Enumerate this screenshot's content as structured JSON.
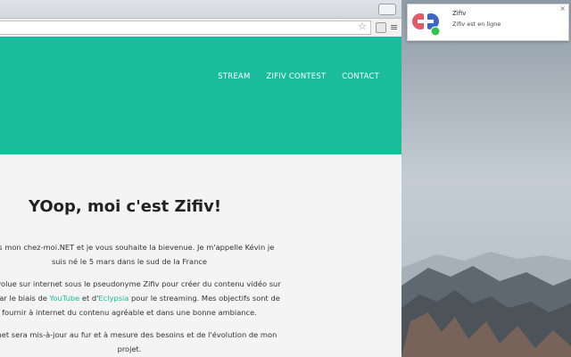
{
  "browser": {
    "star_icon": "star-icon",
    "menu_icon": "hamburger-menu-icon"
  },
  "nav": {
    "items": [
      "STREAM",
      "ZIFIV CONTEST",
      "CONTACT"
    ]
  },
  "main": {
    "headline": "YOop, moi c'est Zifiv!",
    "para1_line1": "dans mon chez-moi.NET et je vous souhaite la bievenue. Je m'appelle Kévin je",
    "para1_line2": "suis né le 5 mars dans le sud de la France",
    "para2_line1": "nt j'évolue sur internet sous le pseudonyme Zifiv pour créer du contenu vidéo sur",
    "para2_line2_pre": "eux par le biais de ",
    "para2_link1": "YouTube",
    "para2_mid": " et d'",
    "para2_link2": "Eclypsia",
    "para2_line2_post": " pour le streaming. Mes objectifs sont de",
    "para2_line3": "fournir à internet du contenu agréable et dans une bonne ambiance.",
    "para3_line1": "nternet sera mis-à-jour au fur et à mesure des besoins et de l'évolution de mon",
    "para3_line2": "projet."
  },
  "notification": {
    "title": "Zifiv",
    "message": "Zifiv est en ligne",
    "close": "×"
  },
  "colors": {
    "accent": "#1abc9c"
  }
}
